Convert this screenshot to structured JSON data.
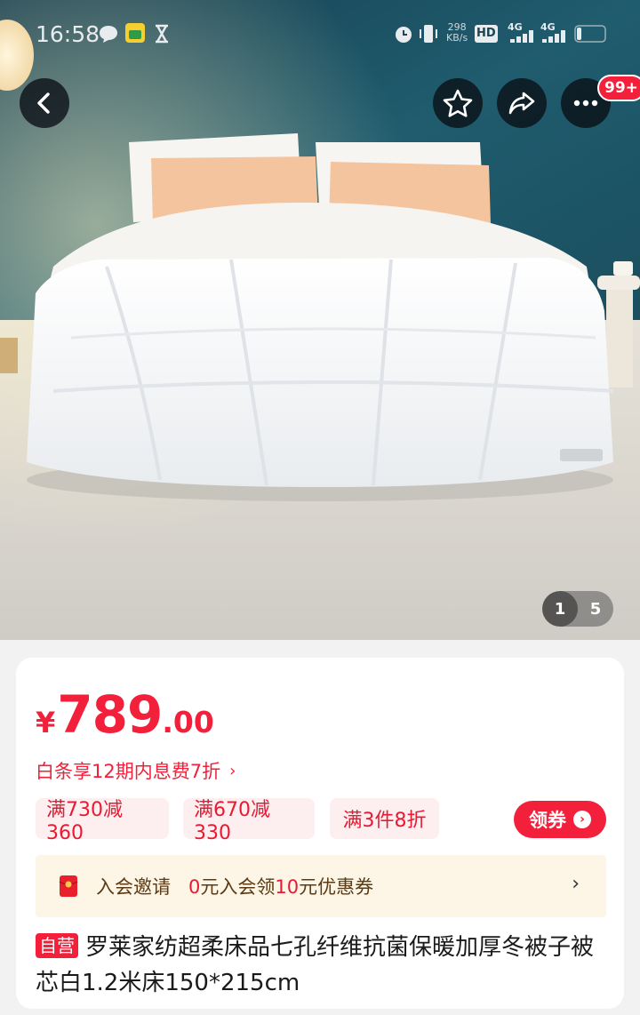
{
  "status_bar": {
    "time": "16:58",
    "net_speed_value": "298",
    "net_speed_unit": "KB/s",
    "hd_label": "HD",
    "signal1": "4G",
    "signal2": "4G"
  },
  "nav": {
    "more_badge": "99+"
  },
  "gallery": {
    "current": "1",
    "total": "5"
  },
  "product": {
    "currency": "¥",
    "price_int": "789",
    "price_dec": ".00",
    "installment_text": "白条享12期内息费7折",
    "installment_arrow": "›",
    "promos": [
      "满730减360",
      "满670减330",
      "满3件8折"
    ],
    "coupon_label": "领券",
    "coupon_chevron": "›",
    "member": {
      "label": "入会邀请",
      "offer_a": "0",
      "offer_b": "元入会领",
      "offer_c": "10",
      "offer_d": "元优惠券",
      "arrow": "›"
    },
    "title_tag": "自营",
    "title": "罗莱家纺超柔床品七孔纤维抗菌保暖加厚冬被子被芯白1.2米床150*215cm"
  },
  "colors": {
    "accent": "#f2203a",
    "wall": "#1f5c6e",
    "floor": "#dcdad4"
  }
}
